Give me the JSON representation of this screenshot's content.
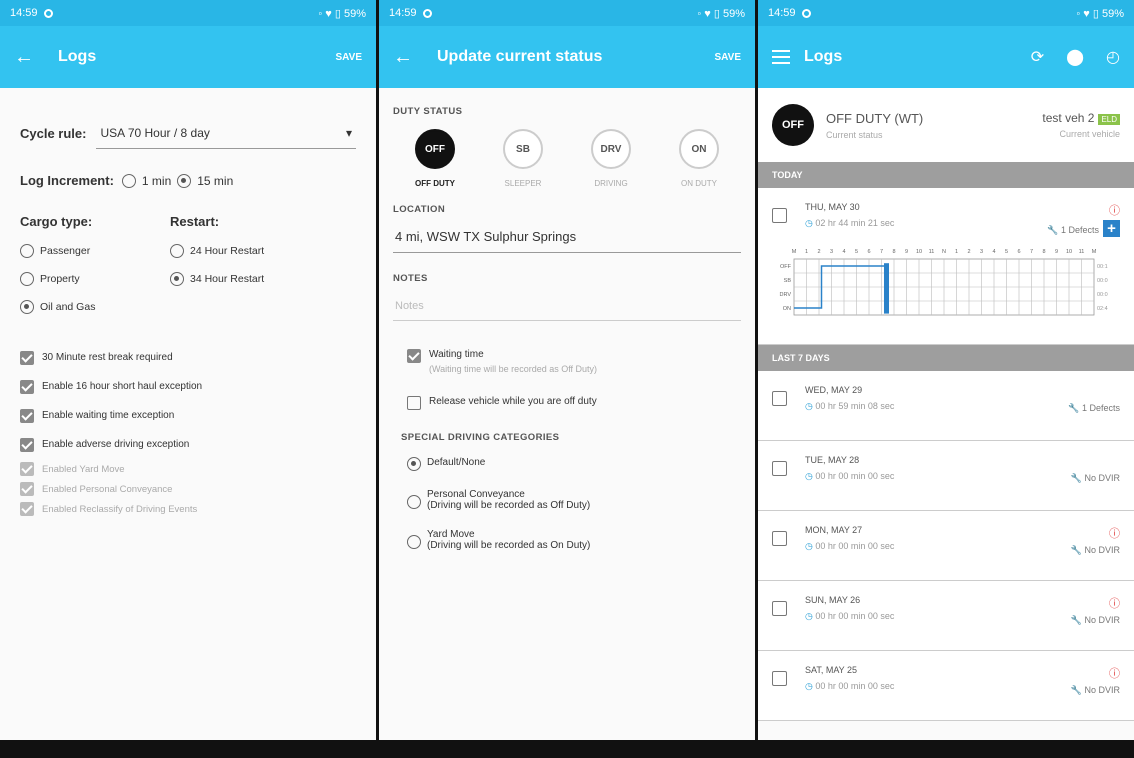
{
  "status_bar": {
    "time": "14:59",
    "battery": "59%"
  },
  "screen1": {
    "title": "Logs",
    "action": "SAVE",
    "cycle_label": "Cycle rule:",
    "cycle_value": "USA 70 Hour / 8 day",
    "log_increment_label": "Log Increment:",
    "log_increment_options": [
      "1 min",
      "15 min"
    ],
    "cargo_label": "Cargo type:",
    "cargo_options": [
      "Passenger",
      "Property",
      "Oil and Gas"
    ],
    "restart_label": "Restart:",
    "restart_options": [
      "24 Hour Restart",
      "34 Hour Restart"
    ],
    "checks": [
      "30 Minute rest break required",
      "Enable 16 hour short haul exception",
      "Enable waiting time exception",
      "Enable adverse driving exception"
    ],
    "disabled_checks": [
      "Enabled Yard Move",
      "Enabled Personal Conveyance",
      "Enabled Reclassify of Driving Events"
    ]
  },
  "screen2": {
    "title": "Update current status",
    "action": "SAVE",
    "duty_status_label": "DUTY STATUS",
    "duty_options": [
      {
        "code": "OFF",
        "label": "OFF DUTY"
      },
      {
        "code": "SB",
        "label": "SLEEPER"
      },
      {
        "code": "DRV",
        "label": "DRIVING"
      },
      {
        "code": "ON",
        "label": "ON DUTY"
      }
    ],
    "location_label": "LOCATION",
    "location_value": "4 mi, WSW TX Sulphur Springs",
    "notes_label": "NOTES",
    "notes_placeholder": "Notes",
    "waiting_label": "Waiting time",
    "waiting_sub": "(Waiting time will be recorded as Off Duty)",
    "release_label": "Release vehicle while you are off duty",
    "special_label": "SPECIAL DRIVING CATEGORIES",
    "special_options": [
      {
        "title": "Default/None",
        "sub": ""
      },
      {
        "title": "Personal Conveyance",
        "sub": "(Driving will be recorded as Off Duty)"
      },
      {
        "title": "Yard Move",
        "sub": "(Driving will be recorded as On Duty)"
      }
    ]
  },
  "screen3": {
    "title": "Logs",
    "current": {
      "code": "OFF",
      "status": "OFF DUTY (WT)",
      "status_sub": "Current status",
      "vehicle": "test veh 2",
      "vehicle_sub": "Current vehicle",
      "vehicle_badge": "ELD"
    },
    "today_label": "TODAY",
    "today": {
      "date": "THU, MAY 30",
      "duration": "02 hr 44 min 21 sec",
      "defects": "1 Defects"
    },
    "grid_rows": [
      "OFF",
      "SB",
      "DRV",
      "ON"
    ],
    "grid_hours": [
      "M",
      "1",
      "2",
      "3",
      "4",
      "5",
      "6",
      "7",
      "8",
      "9",
      "10",
      "11",
      "N",
      "1",
      "2",
      "3",
      "4",
      "5",
      "6",
      "7",
      "8",
      "9",
      "10",
      "11",
      "M"
    ],
    "grid_totals": [
      "00:1",
      "00:0",
      "00:0",
      "02:4"
    ],
    "last7_label": "LAST 7 DAYS",
    "days": [
      {
        "date": "WED, MAY 29",
        "duration": "00 hr 59 min 08 sec",
        "right": "1 Defects",
        "alert": false
      },
      {
        "date": "TUE, MAY 28",
        "duration": "00 hr 00 min 00 sec",
        "right": "No DVIR",
        "alert": false
      },
      {
        "date": "MON, MAY 27",
        "duration": "00 hr 00 min 00 sec",
        "right": "No DVIR",
        "alert": true
      },
      {
        "date": "SUN, MAY 26",
        "duration": "00 hr 00 min 00 sec",
        "right": "No DVIR",
        "alert": true
      },
      {
        "date": "SAT, MAY 25",
        "duration": "00 hr 00 min 00 sec",
        "right": "No DVIR",
        "alert": true
      }
    ]
  },
  "colors": {
    "status_bar": "#29b6e6",
    "app_bar": "#33c3f0",
    "section_header": "#9e9e9e",
    "accent_blue": "#2a82c9",
    "alert_red": "#e04040"
  }
}
